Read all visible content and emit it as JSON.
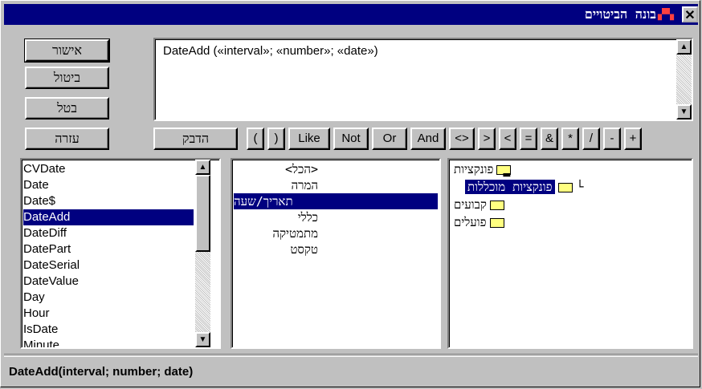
{
  "window": {
    "title": "בונה הביטויים",
    "close_label": "✕"
  },
  "buttons": {
    "ok": "אישור",
    "cancel": "ביטול",
    "undo": "בטל",
    "help": "עזרה",
    "paste": "הדבק"
  },
  "expression": "DateAdd («interval»; «number»; «date»)",
  "operators": [
    "(",
    ")",
    "Like",
    "Not",
    "Or",
    "And",
    "<>",
    ">",
    "<",
    "=",
    "&",
    "*",
    "/",
    "-",
    "+"
  ],
  "function_list": [
    "CVDate",
    "Date",
    "Date$",
    "DateAdd",
    "DateDiff",
    "DatePart",
    "DateSerial",
    "DateValue",
    "Day",
    "Hour",
    "IsDate",
    "Minute"
  ],
  "function_selected": "DateAdd",
  "category_list": [
    "<הכל>",
    "המרה",
    "תאריך/שעה",
    "כללי",
    "מתמטיקה",
    "טקסט"
  ],
  "category_selected": "תאריך/שעה",
  "tree": {
    "functions": "פונקציות",
    "builtin": "פונקציות מוכללות",
    "constants": "קבועים",
    "operators": "פועלים"
  },
  "status_text": "DateAdd(interval; number; date)",
  "colors": {
    "titlebar": "#000080",
    "selection": "#000080",
    "face": "#c0c0c0"
  }
}
